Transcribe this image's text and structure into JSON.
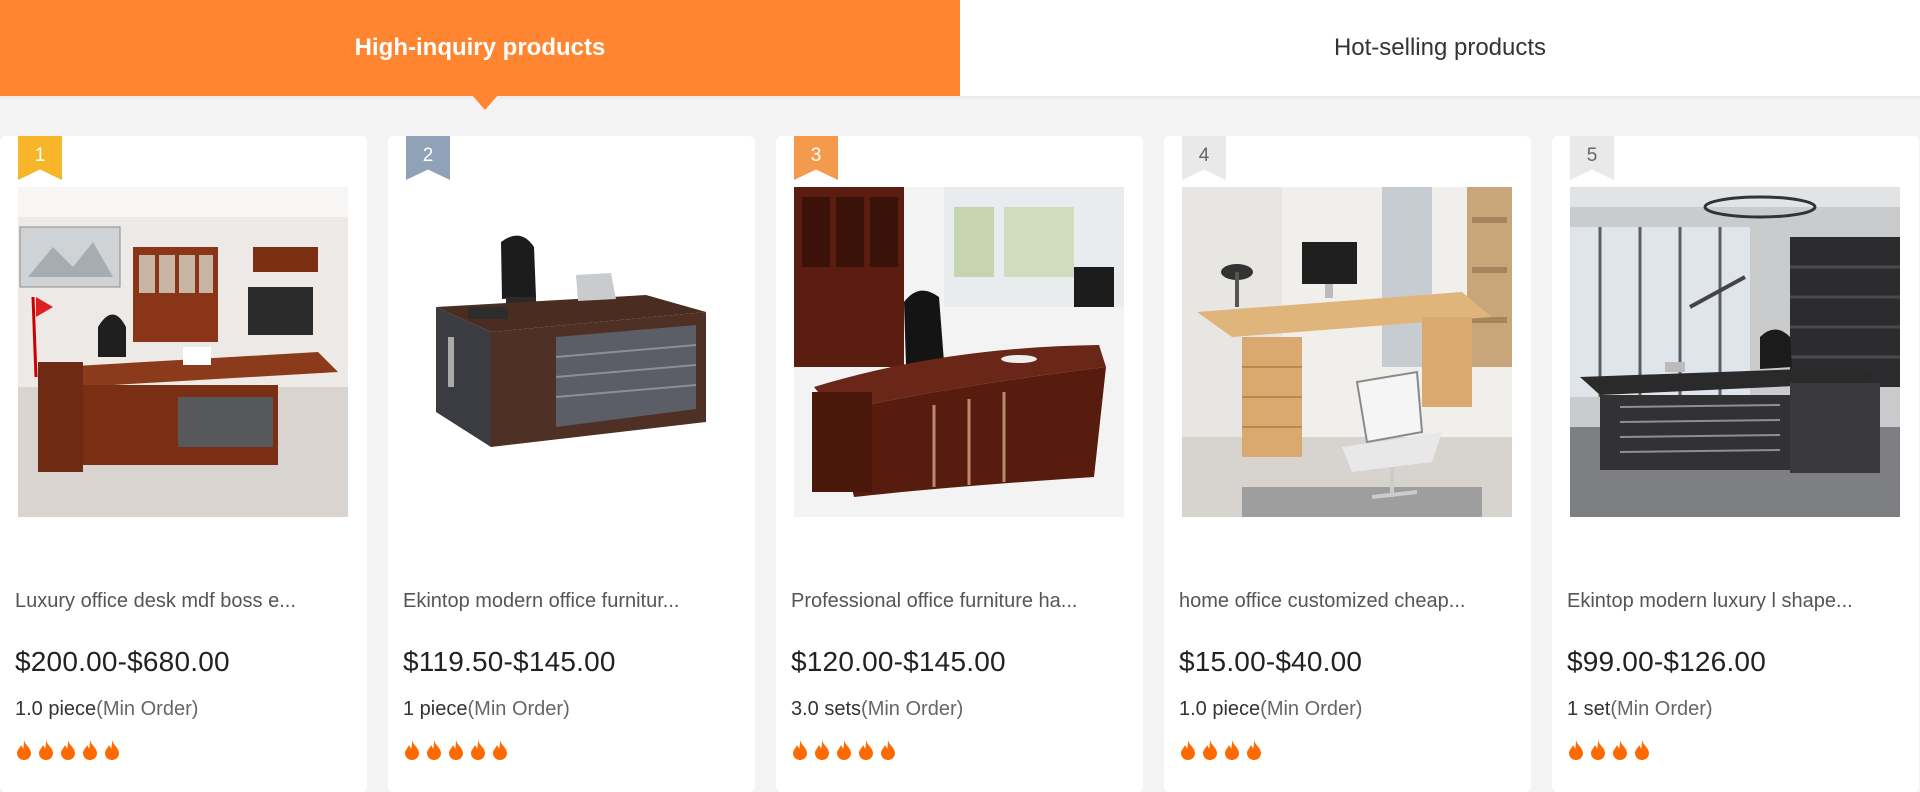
{
  "tabs": {
    "active_label": "High-inquiry products",
    "inactive_label": "Hot-selling products"
  },
  "colors": {
    "accent": "#ff8530",
    "gold": "#f6b52b",
    "silver": "#8fa2b8",
    "bronze": "#f49a4c",
    "flame": "#ff6a00"
  },
  "products": [
    {
      "rank": "1",
      "title": "Luxury office desk mdf boss e...",
      "price": "$200.00-$680.00",
      "moq_value": "1.0 piece",
      "moq_suffix": "(Min Order)",
      "rating_icons": 5
    },
    {
      "rank": "2",
      "title": "Ekintop modern office furnitur...",
      "price": "$119.50-$145.00",
      "moq_value": "1 piece",
      "moq_suffix": "(Min Order)",
      "rating_icons": 5
    },
    {
      "rank": "3",
      "title": "Professional office furniture ha...",
      "price": "$120.00-$145.00",
      "moq_value": "3.0 sets",
      "moq_suffix": "(Min Order)",
      "rating_icons": 5
    },
    {
      "rank": "4",
      "title": "home office customized cheap...",
      "price": "$15.00-$40.00",
      "moq_value": "1.0 piece",
      "moq_suffix": "(Min Order)",
      "rating_icons": 4
    },
    {
      "rank": "5",
      "title": "Ekintop modern luxury l shape...",
      "price": "$99.00-$126.00",
      "moq_value": "1 set",
      "moq_suffix": "(Min Order)",
      "rating_icons": 4
    }
  ]
}
